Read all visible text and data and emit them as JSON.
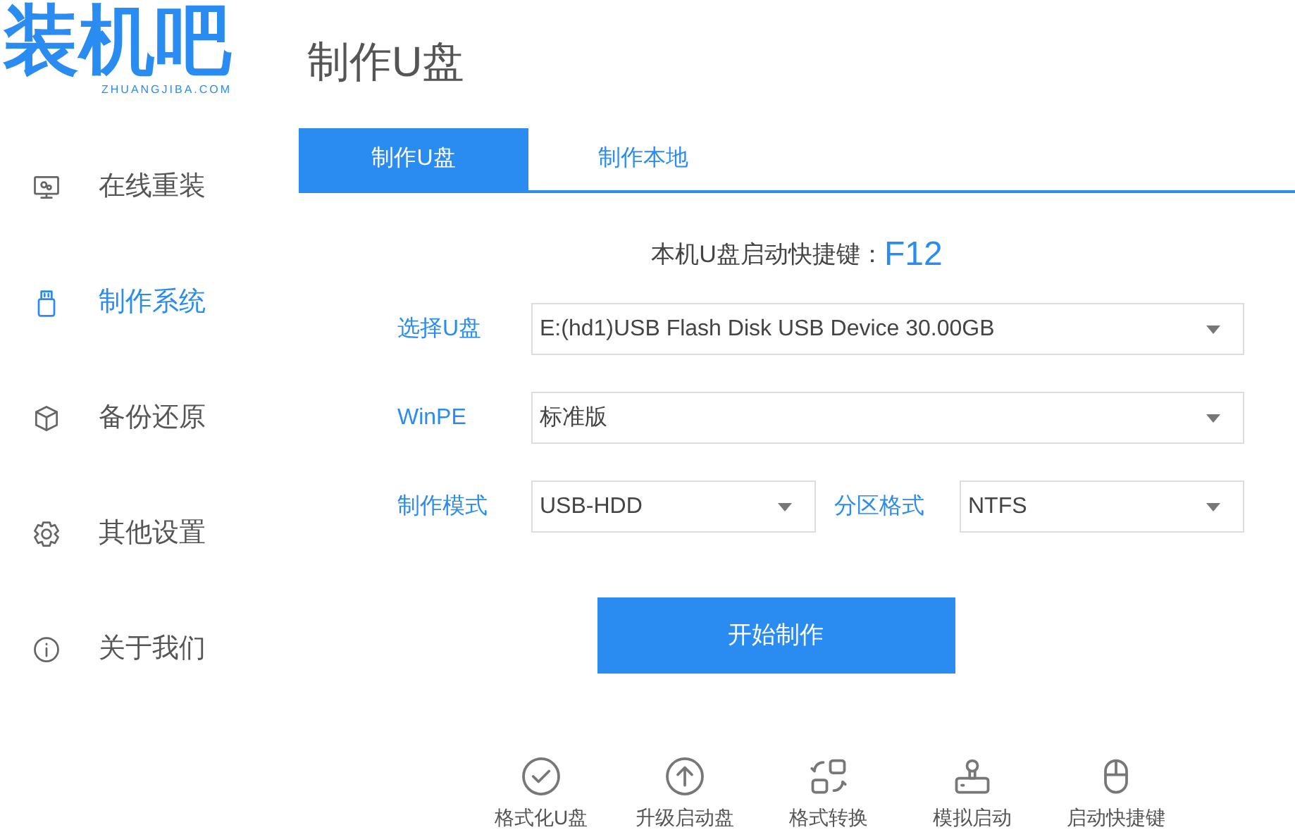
{
  "logo": {
    "text": "装机吧",
    "subtitle": "ZHUANGJIBA.COM"
  },
  "sidebar": {
    "items": [
      {
        "kind": "monitor",
        "label": "在线重装",
        "selected": false
      },
      {
        "kind": "usb",
        "label": "制作系统",
        "selected": true
      },
      {
        "kind": "cube",
        "label": "备份还原",
        "selected": false
      },
      {
        "kind": "gear",
        "label": "其他设置",
        "selected": false
      },
      {
        "kind": "info",
        "label": "关于我们",
        "selected": false
      }
    ]
  },
  "page_title": "制作U盘",
  "tabs": [
    {
      "label": "制作U盘",
      "selected": true
    },
    {
      "label": "制作本地",
      "selected": false
    }
  ],
  "hotkey": {
    "label": "本机U盘启动快捷键：",
    "key": "F12"
  },
  "form_rows": [
    {
      "fields": [
        {
          "label": "选择U盘",
          "value": "E:(hd1)USB Flash Disk USB Device 30.00GB"
        }
      ]
    },
    {
      "fields": [
        {
          "label": "WinPE",
          "value": "标准版"
        }
      ]
    },
    {
      "fields": [
        {
          "label": "制作模式",
          "value": "USB-HDD"
        },
        {
          "label": "分区格式",
          "value": "NTFS"
        }
      ]
    }
  ],
  "start_button": "开始制作",
  "tools": [
    {
      "kind": "check",
      "label": "格式化U盘"
    },
    {
      "kind": "upload",
      "label": "升级启动盘"
    },
    {
      "kind": "convert",
      "label": "格式转换"
    },
    {
      "kind": "stamp",
      "label": "模拟启动"
    },
    {
      "kind": "mouse",
      "label": "启动快捷键"
    }
  ]
}
